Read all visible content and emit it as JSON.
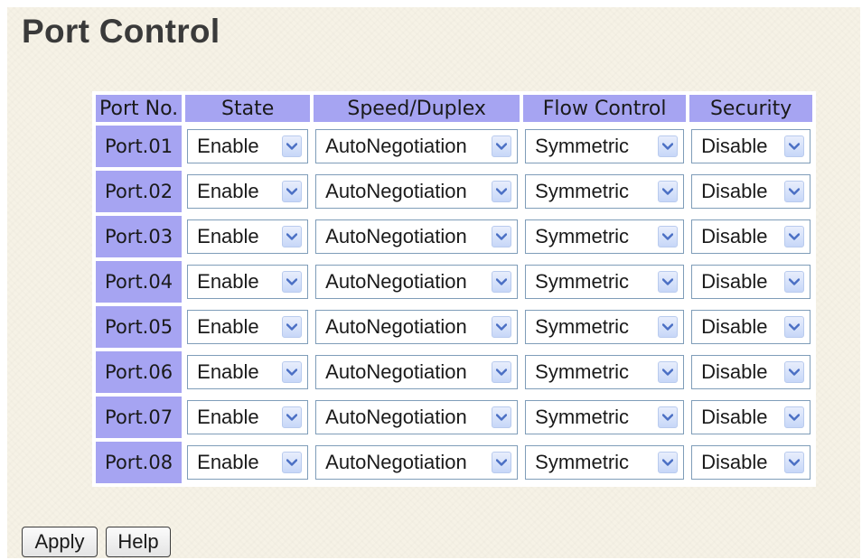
{
  "page": {
    "title": "Port Control"
  },
  "table": {
    "headers": [
      "Port No.",
      "State",
      "Speed/Duplex",
      "Flow Control",
      "Security"
    ],
    "rows": [
      {
        "port": "Port.01",
        "state": "Enable",
        "speed": "AutoNegotiation",
        "flow": "Symmetric",
        "security": "Disable"
      },
      {
        "port": "Port.02",
        "state": "Enable",
        "speed": "AutoNegotiation",
        "flow": "Symmetric",
        "security": "Disable"
      },
      {
        "port": "Port.03",
        "state": "Enable",
        "speed": "AutoNegotiation",
        "flow": "Symmetric",
        "security": "Disable"
      },
      {
        "port": "Port.04",
        "state": "Enable",
        "speed": "AutoNegotiation",
        "flow": "Symmetric",
        "security": "Disable"
      },
      {
        "port": "Port.05",
        "state": "Enable",
        "speed": "AutoNegotiation",
        "flow": "Symmetric",
        "security": "Disable"
      },
      {
        "port": "Port.06",
        "state": "Enable",
        "speed": "AutoNegotiation",
        "flow": "Symmetric",
        "security": "Disable"
      },
      {
        "port": "Port.07",
        "state": "Enable",
        "speed": "AutoNegotiation",
        "flow": "Symmetric",
        "security": "Disable"
      },
      {
        "port": "Port.08",
        "state": "Enable",
        "speed": "AutoNegotiation",
        "flow": "Symmetric",
        "security": "Disable"
      }
    ]
  },
  "buttons": {
    "apply": "Apply",
    "help": "Help"
  },
  "colors": {
    "header_bg": "#a6a4f2",
    "page_bg": "#f6f2e6",
    "arrow_color": "#4a6fc4"
  },
  "icons": {
    "dropdown": "chevron-down-icon"
  }
}
